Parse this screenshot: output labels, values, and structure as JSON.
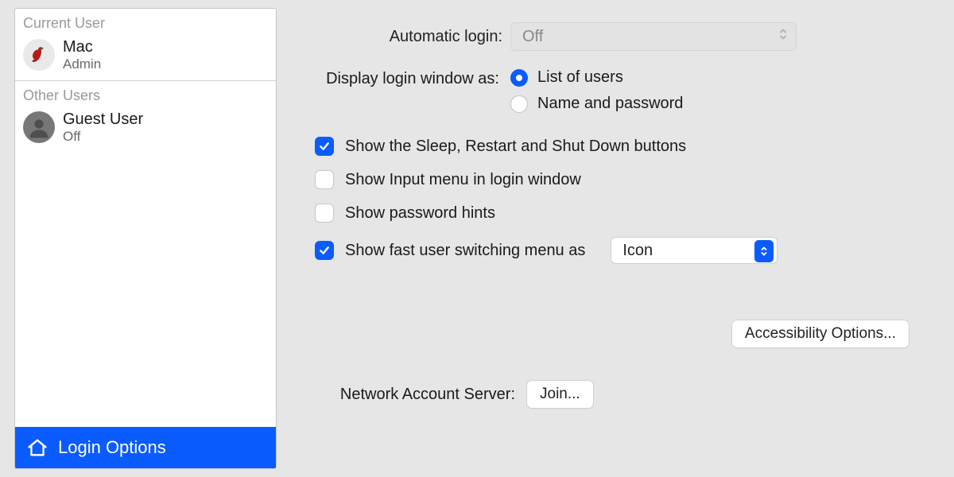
{
  "sidebar": {
    "sections": {
      "current_header": "Current User",
      "other_header": "Other Users"
    },
    "users": [
      {
        "name": "Mac",
        "subtitle": "Admin",
        "avatar_kind": "pepper"
      },
      {
        "name": "Guest User",
        "subtitle": "Off",
        "avatar_kind": "silhouette"
      }
    ],
    "login_options_label": "Login Options"
  },
  "main": {
    "automatic_login_label": "Automatic login:",
    "automatic_login_value": "Off",
    "display_as_label": "Display login window as:",
    "radio_options": [
      {
        "label": "List of users",
        "checked": true
      },
      {
        "label": "Name and password",
        "checked": false
      }
    ],
    "checks": [
      {
        "label": "Show the Sleep, Restart and Shut Down buttons",
        "checked": true
      },
      {
        "label": "Show Input menu in login window",
        "checked": false
      },
      {
        "label": "Show password hints",
        "checked": false
      },
      {
        "label": "Show fast user switching menu as",
        "checked": true,
        "select_value": "Icon"
      }
    ],
    "accessibility_button": "Accessibility Options...",
    "network_label": "Network Account Server:",
    "join_button": "Join..."
  },
  "colors": {
    "accent": "#0a5cff",
    "muted_text": "#9a9a9a",
    "panel_bg": "#e6e6e6"
  }
}
